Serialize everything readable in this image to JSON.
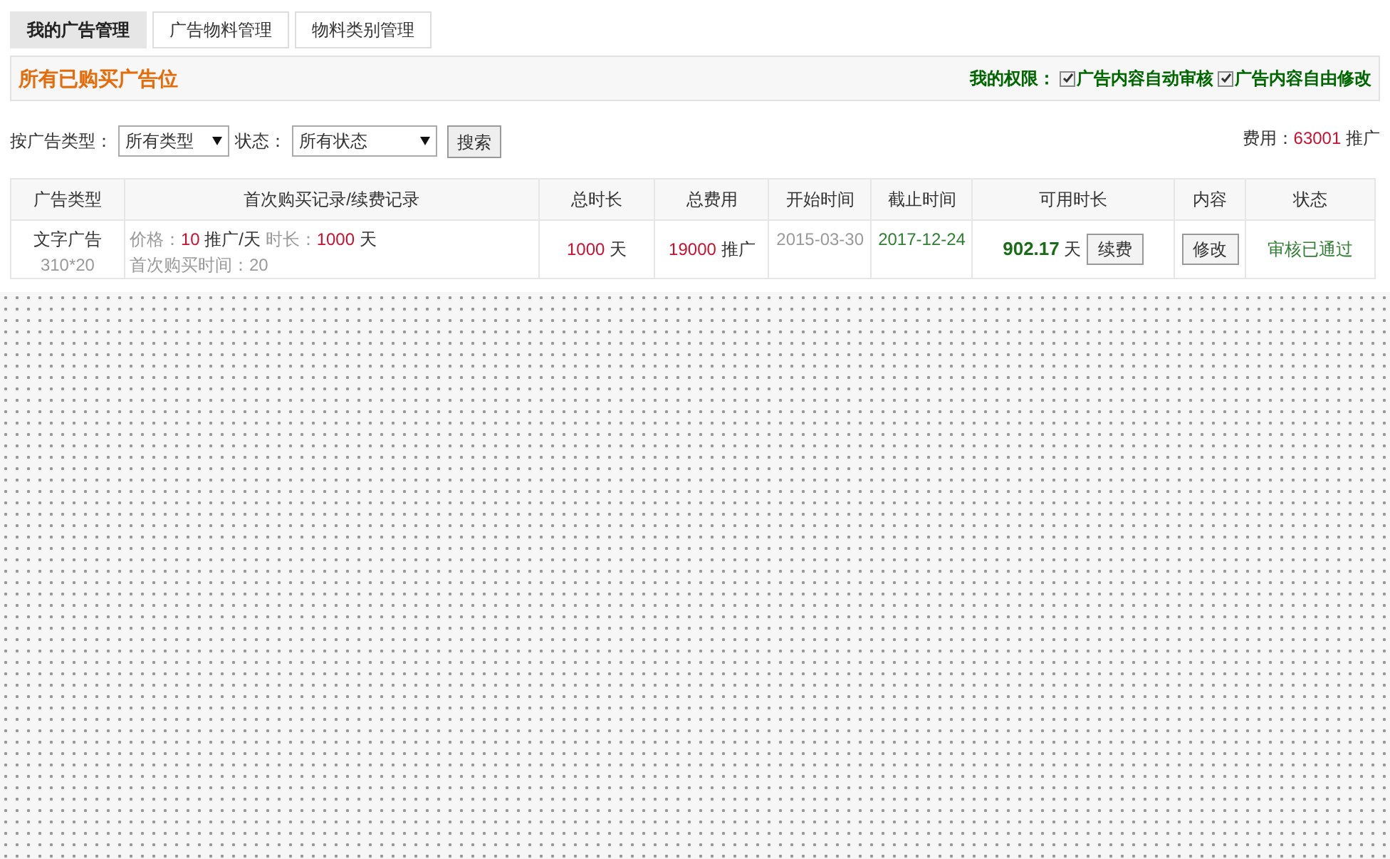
{
  "tabs": [
    {
      "label": "我的广告管理",
      "selected": true
    },
    {
      "label": "广告物料管理",
      "selected": false
    },
    {
      "label": "物料类别管理",
      "selected": false
    }
  ],
  "header": {
    "title": "所有已购买广告位",
    "permissions_label": "我的权限：",
    "permissions": [
      {
        "label": "广告内容自动审核",
        "checked": true
      },
      {
        "label": "广告内容自由修改",
        "checked": true
      }
    ]
  },
  "filters": {
    "type_label": "按广告类型：",
    "type_value": "所有类型",
    "status_label": "状态：",
    "status_value": "所有状态",
    "search_button": "搜索"
  },
  "fee": {
    "label": "费用：",
    "value": "63001",
    "unit": "推广"
  },
  "table": {
    "columns": [
      "广告类型",
      "首次购买记录/续费记录",
      "总时长",
      "总费用",
      "开始时间",
      "截止时间",
      "可用时长",
      "内容",
      "状态"
    ],
    "rows": [
      {
        "type": "文字广告",
        "size": "310*20",
        "price_label": "价格：",
        "price": "10",
        "price_unit": "推广/天",
        "duration_label": "时长：",
        "duration": "1000",
        "duration_unit": "天",
        "first_purchase": "首次购买时间：20",
        "total_duration": "1000",
        "total_duration_unit": "天",
        "total_cost": "19000",
        "total_cost_unit": "推广",
        "start": "2015-03-30",
        "end": "2017-12-24",
        "available": "902.17",
        "available_unit": "天",
        "renew_button": "续费",
        "edit_button": "修改",
        "status": "审核已通过"
      }
    ]
  }
}
